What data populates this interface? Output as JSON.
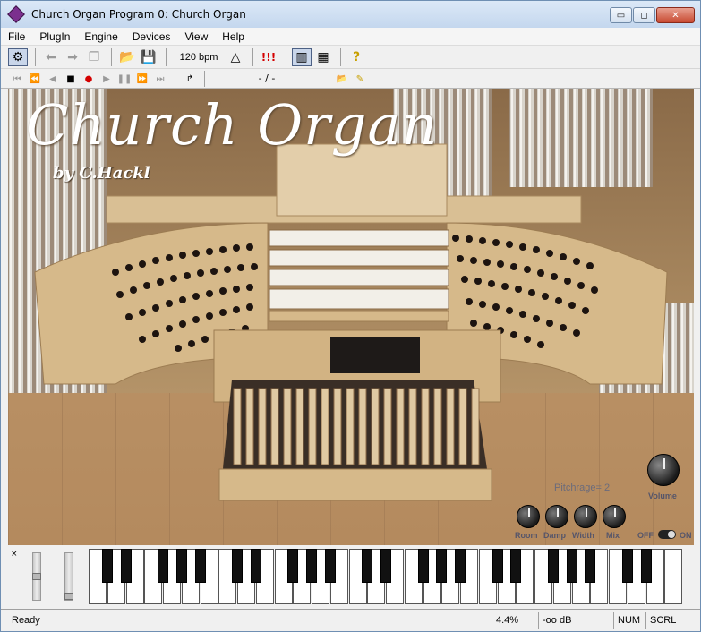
{
  "window": {
    "title": "Church Organ Program 0: Church Organ",
    "minimize": "▭",
    "maximize": "◻",
    "close": "✕"
  },
  "menu": [
    "File",
    "PlugIn",
    "Engine",
    "Devices",
    "View",
    "Help"
  ],
  "toolbar": {
    "bpm": "120 bpm",
    "warning": "!!!",
    "help": "?"
  },
  "transport": {
    "position": "- / -"
  },
  "instrument": {
    "title": "Church Organ",
    "byline": "by C.Hackl",
    "pitchrange": "Pitchrage= 2",
    "knobs": [
      "Room",
      "Damp",
      "Width",
      "Mix"
    ],
    "volume_label": "Volume",
    "switch_off": "OFF",
    "switch_on": "ON",
    "switch_state": "on"
  },
  "keyboard": {
    "close": "×"
  },
  "status": {
    "text": "Ready",
    "cpu": "4.4%",
    "level": "-oo dB",
    "num": "NUM",
    "scrl": "SCRL"
  },
  "colors": {
    "wood": "#c9a978",
    "floor": "#b08a62",
    "title_gradient": "#c4d7ee"
  }
}
